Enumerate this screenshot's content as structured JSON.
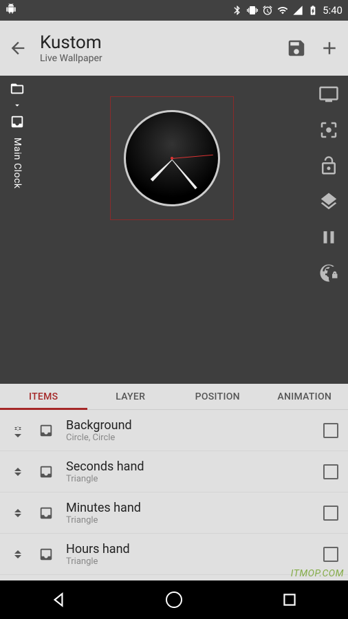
{
  "status": {
    "time": "5:40"
  },
  "appbar": {
    "title": "Kustom",
    "subtitle": "Live Wallpaper"
  },
  "rail": {
    "breadcrumb": "Main Clock"
  },
  "tabs": [
    {
      "label": "ITEMS",
      "active": true
    },
    {
      "label": "LAYER",
      "active": false
    },
    {
      "label": "POSITION",
      "active": false
    },
    {
      "label": "ANIMATION",
      "active": false
    }
  ],
  "items": [
    {
      "title": "Background",
      "subtitle": "Circle, Circle"
    },
    {
      "title": "Seconds hand",
      "subtitle": "Triangle"
    },
    {
      "title": "Minutes hand",
      "subtitle": "Triangle"
    },
    {
      "title": "Hours hand",
      "subtitle": "Triangle"
    }
  ],
  "watermark": "ITMOP.COM"
}
